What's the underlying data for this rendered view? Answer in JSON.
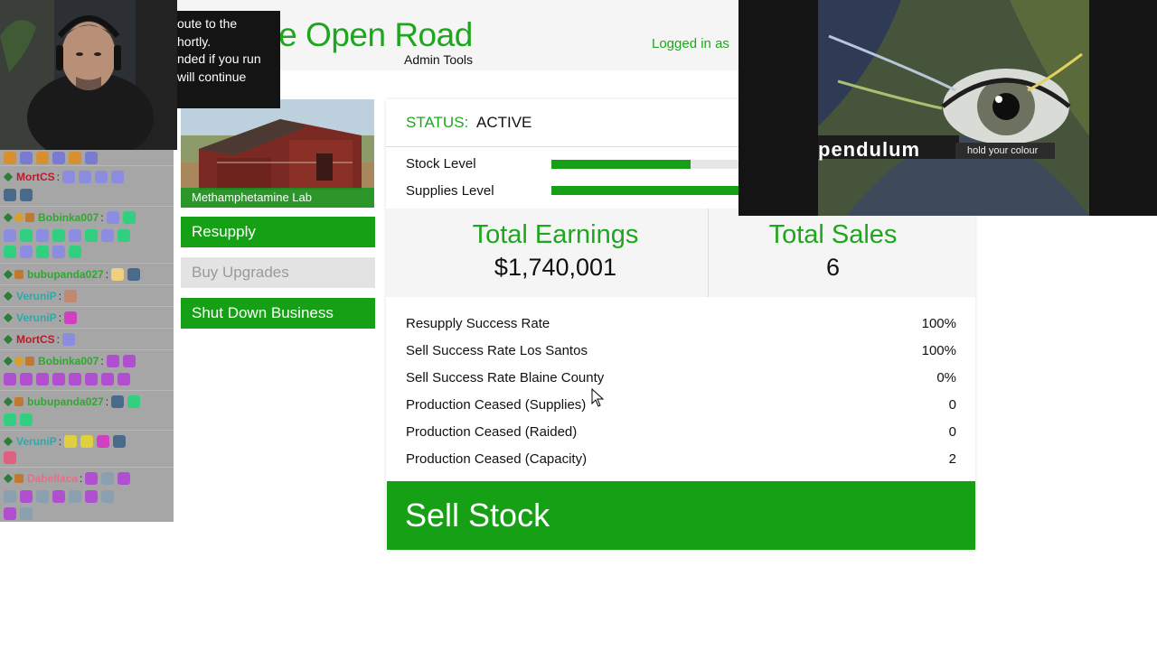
{
  "site": {
    "title": "The Open Road",
    "subtitle": "Admin Tools",
    "logged_in": "Logged in as",
    "title_color": "#1ea71e"
  },
  "notice": {
    "lines": [
      "oute to the",
      "hortly.",
      "nded if you run",
      "will continue"
    ]
  },
  "chat": {
    "messages": [
      {
        "user": "MortCS",
        "color": "#c0182a",
        "badges": [
          "diamond"
        ]
      },
      {
        "user": "Bobinka007",
        "color": "#2ea82e",
        "badges": [
          "diamond",
          "gold",
          "box"
        ]
      },
      {
        "user": "bubupanda027",
        "color": "#2ea82e",
        "badges": [
          "diamond",
          "box"
        ]
      },
      {
        "user": "VeruniP",
        "color": "#2ea8a8",
        "badges": [
          "diamond"
        ]
      },
      {
        "user": "VeruniP",
        "color": "#2ea8a8",
        "badges": [
          "diamond"
        ]
      },
      {
        "user": "MortCS",
        "color": "#c0182a",
        "badges": [
          "diamond"
        ]
      },
      {
        "user": "Bobinka007",
        "color": "#2ea82e",
        "badges": [
          "diamond",
          "gold",
          "box"
        ]
      },
      {
        "user": "bubupanda027",
        "color": "#2ea82e",
        "badges": [
          "diamond",
          "box"
        ]
      },
      {
        "user": "VeruniP",
        "color": "#2ea8a8",
        "badges": [
          "diamond"
        ]
      },
      {
        "user": "Dabellaca",
        "color": "#e0708a",
        "badges": [
          "diamond",
          "box"
        ]
      }
    ]
  },
  "business": {
    "name": "Methamphetamine Lab",
    "resupply_label": "Resupply",
    "upgrades_label": "Buy Upgrades",
    "shutdown_label": "Shut Down Business"
  },
  "status": {
    "label": "STATUS:",
    "value": "ACTIVE"
  },
  "levels": {
    "stock_label": "Stock Level",
    "stock_fraction": 0.35,
    "supplies_label": "Supplies Level",
    "supplies_fraction": 1.0
  },
  "earnings": {
    "title": "Total Earnings",
    "value": "$1,740,001"
  },
  "sales": {
    "title": "Total Sales",
    "value": "6"
  },
  "stats": [
    {
      "label": "Resupply Success Rate",
      "value": "100%"
    },
    {
      "label": "Sell Success Rate Los Santos",
      "value": "100%"
    },
    {
      "label": "Sell Success Rate Blaine County",
      "value": "0%"
    },
    {
      "label": "Production Ceased (Supplies)",
      "value": "0"
    },
    {
      "label": "Production Ceased (Raided)",
      "value": "0"
    },
    {
      "label": "Production Ceased (Capacity)",
      "value": "2"
    }
  ],
  "sell_label": "Sell Stock",
  "album": {
    "band": "pendulum",
    "title": "hold your colour"
  },
  "colors": {
    "accent_green": "#16a016",
    "disabled_button": "#e3e3e3",
    "chat_background": "#a6a6a6"
  }
}
